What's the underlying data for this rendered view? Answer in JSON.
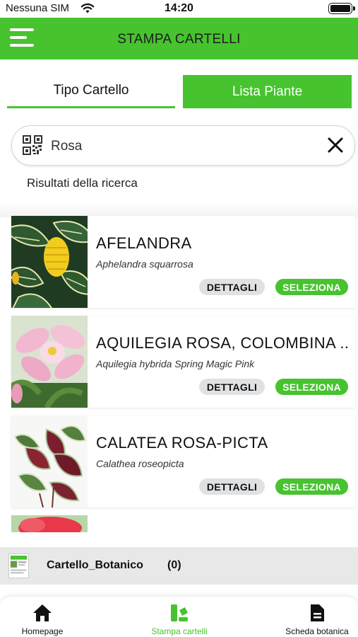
{
  "status_bar": {
    "carrier": "Nessuna SIM",
    "time": "14:20"
  },
  "header": {
    "title": "STAMPA CARTELLI"
  },
  "tabs": [
    {
      "label": "Tipo Cartello",
      "active": false
    },
    {
      "label": "Lista Piante",
      "active": true
    }
  ],
  "search": {
    "value": "Rosa"
  },
  "results_label": "Risultati della ricerca",
  "plants": [
    {
      "name": "AFELANDRA",
      "latin": "Aphelandra squarrosa",
      "details_label": "DETTAGLI",
      "select_label": "SELEZIONA"
    },
    {
      "name": "AQUILEGIA ROSA, COLOMBINA ...",
      "latin": "Aquilegia hybrida Spring Magic Pink",
      "details_label": "DETTAGLI",
      "select_label": "SELEZIONA"
    },
    {
      "name": "CALATEA ROSA-PICTA",
      "latin": "Calathea roseopicta",
      "details_label": "DETTAGLI",
      "select_label": "SELEZIONA"
    }
  ],
  "queue": {
    "name": "Cartello_Botanico",
    "count": "(0)"
  },
  "tab_bar": [
    {
      "label": "Homepage",
      "icon": "home-icon",
      "active": false
    },
    {
      "label": "Stampa cartelli",
      "icon": "print-labels-icon",
      "active": true
    },
    {
      "label": "Scheda botanica",
      "icon": "document-icon",
      "active": false
    }
  ],
  "colors": {
    "accent": "#46c32e",
    "button_grey": "#dfe1e3",
    "queue_bg": "#e8e8e8"
  }
}
